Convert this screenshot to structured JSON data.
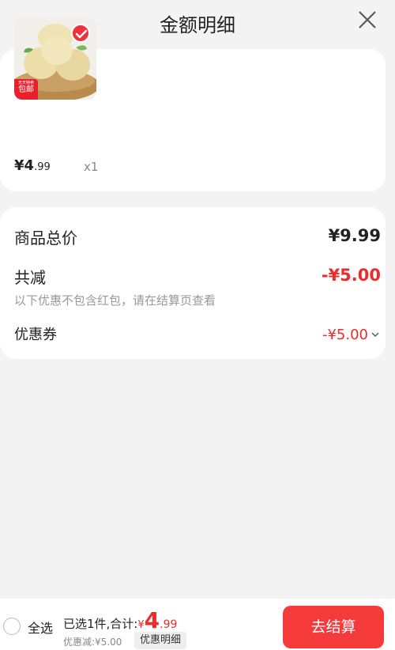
{
  "header": {
    "title": "金额明细"
  },
  "product": {
    "badge_small": "天天特卖",
    "badge_big": "包邮",
    "price_yen": "¥",
    "price_int": "4",
    "price_dec": ".99",
    "quantity": "x1"
  },
  "summary": {
    "total_label": "商品总价",
    "total_value": "¥9.99",
    "reduce_label": "共减",
    "reduce_value": "-¥5.00",
    "reduce_note": "以下优惠不包含红包，请在结算页查看",
    "coupon_label": "优惠券",
    "coupon_value": "-¥5.00"
  },
  "bottom": {
    "select_all": "全选",
    "selected_label": "已选1件,合计:",
    "total_yen": "¥",
    "total_int": "4",
    "total_dec": ".99",
    "discount_text": "优惠减:¥5.00",
    "detail_button": "优惠明细",
    "checkout_button": "去结算"
  },
  "colors": {
    "accent": "#f53a3a",
    "price_red": "#ec2b2b"
  }
}
